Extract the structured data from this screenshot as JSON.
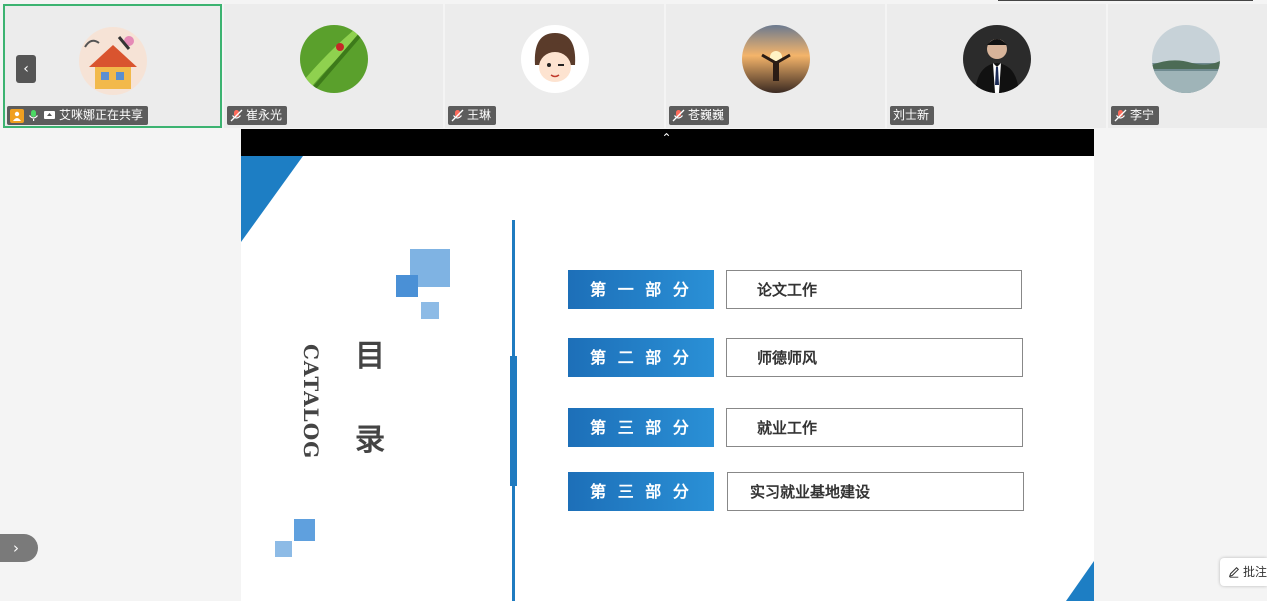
{
  "participants": [
    {
      "name": "艾咪娜正在共享",
      "sharing": true,
      "icons": [
        "person-icon",
        "mic-icon",
        "screen-share-icon"
      ]
    },
    {
      "name": "崔永光",
      "muted": true
    },
    {
      "name": "王琳",
      "muted": true
    },
    {
      "name": "苍巍巍",
      "muted": true
    },
    {
      "name": "刘士新",
      "muted": false
    },
    {
      "name": "李宁",
      "muted": true
    }
  ],
  "nav": {
    "prev": "‹",
    "collapse": "⌃",
    "expand": "›"
  },
  "slide": {
    "title_cn_1": "目",
    "title_cn_2": "录",
    "title_en": "CATALOG",
    "items": [
      {
        "label": "第 一 部 分",
        "text": "论文工作"
      },
      {
        "label": "第 二 部 分",
        "text": "师德师风"
      },
      {
        "label": "第 三 部 分",
        "text": "就业工作"
      },
      {
        "label": "第 三 部 分",
        "text": "实习就业基地建设"
      }
    ],
    "accent_color": "#1d7ec4"
  },
  "annotate": {
    "label": "批注"
  }
}
